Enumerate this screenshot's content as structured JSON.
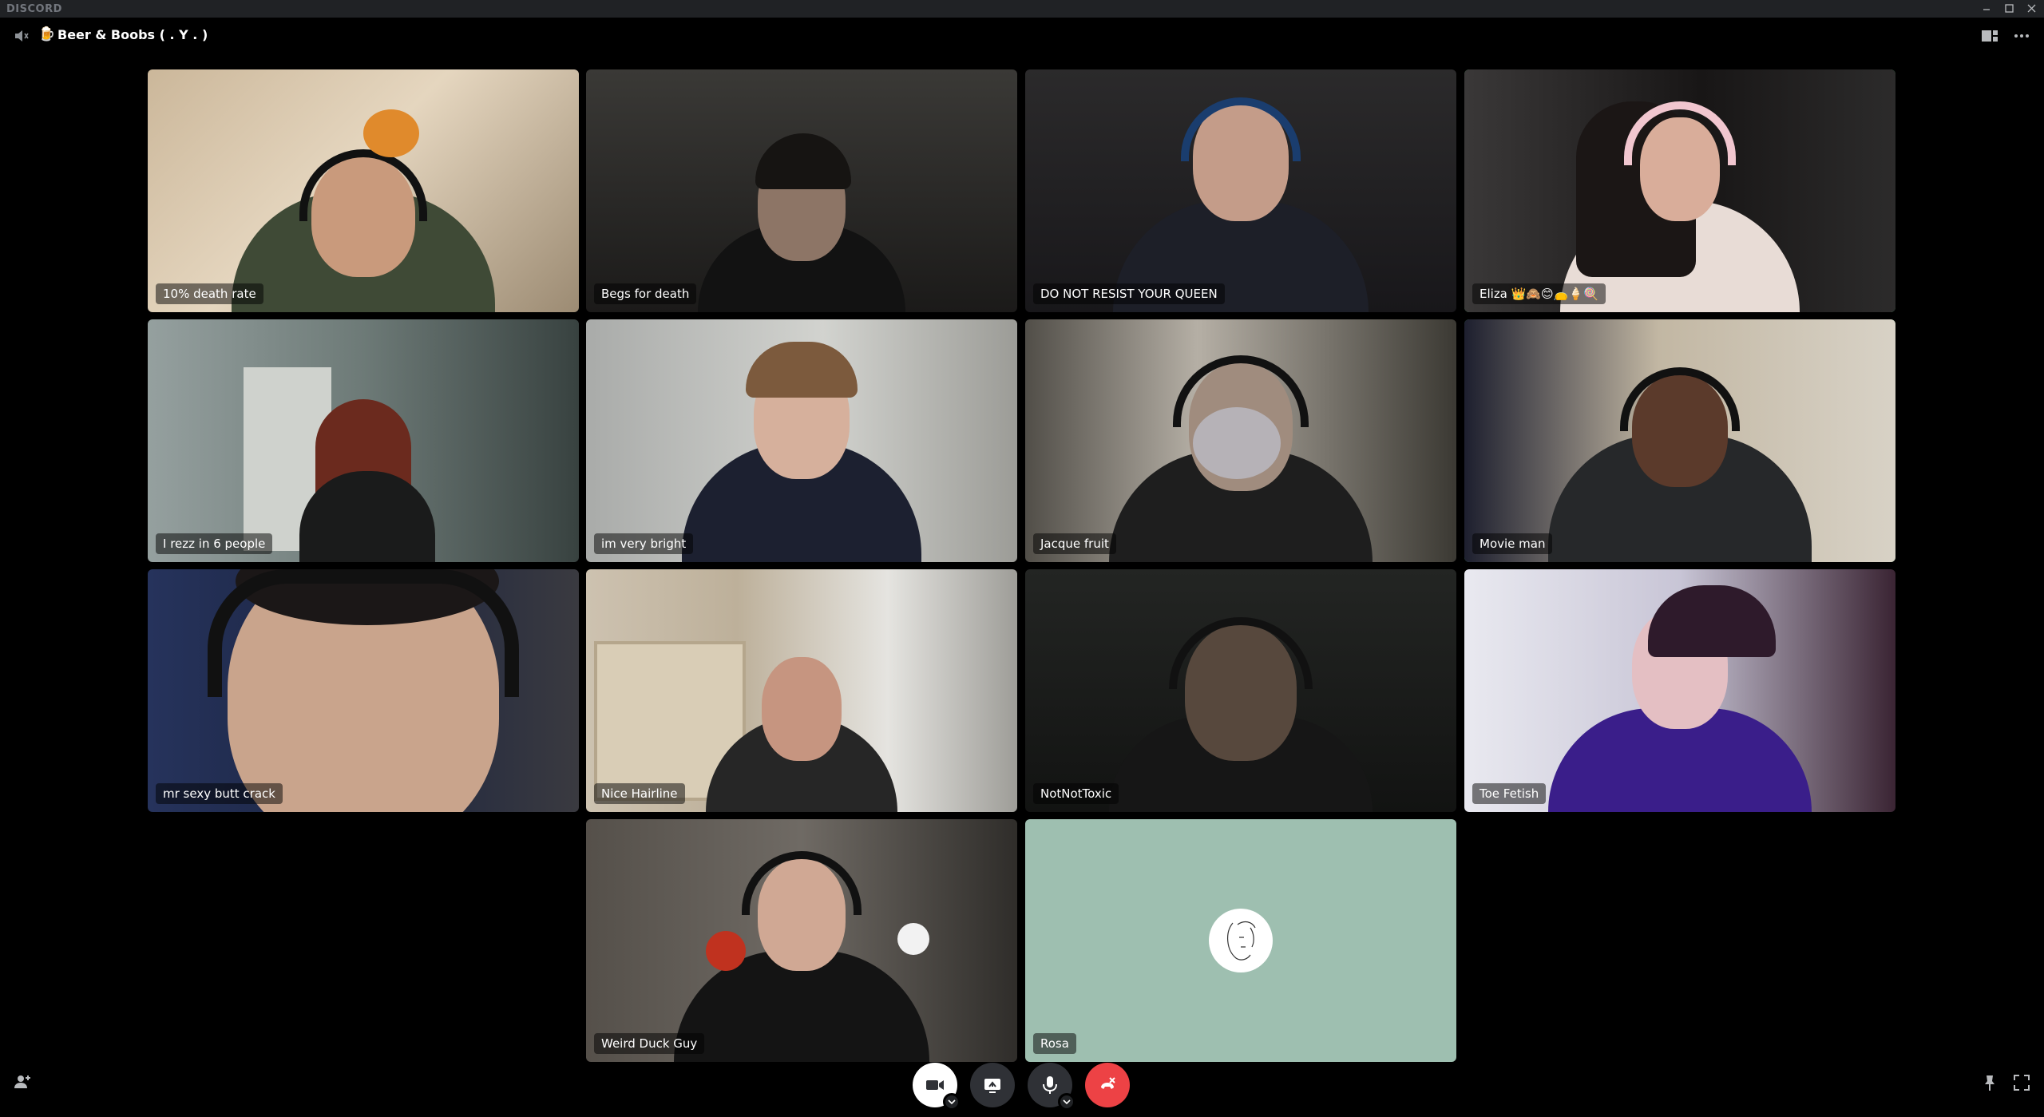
{
  "window": {
    "app_title": "DISCORD"
  },
  "header": {
    "channel_emoji": "🍺",
    "channel_name": "Beer & Boobs ( . Y . )"
  },
  "participants": [
    {
      "name": "10% death rate",
      "speaking": false
    },
    {
      "name": "Begs for death",
      "speaking": false
    },
    {
      "name": "DO NOT RESIST YOUR QUEEN",
      "speaking": false
    },
    {
      "name": "Eliza 👑🙈😊👝🍦🍭",
      "speaking": true
    },
    {
      "name": "I rezz in 6 people",
      "speaking": false
    },
    {
      "name": "im very bright",
      "speaking": false
    },
    {
      "name": "Jacque fruit",
      "speaking": false
    },
    {
      "name": "Movie man",
      "speaking": true
    },
    {
      "name": "mr sexy butt crack",
      "speaking": false
    },
    {
      "name": "Nice Hairline",
      "speaking": false
    },
    {
      "name": "NotNotToxic",
      "speaking": false
    },
    {
      "name": "Toe Fetish",
      "speaking": false
    },
    {
      "name": "Weird Duck Guy",
      "speaking": false
    },
    {
      "name": "Rosa",
      "speaking": false,
      "video": false
    }
  ],
  "icons": {
    "speaker": "speaker-muted-icon",
    "layout": "grid-layout-icon",
    "more": "more-icon",
    "invite": "add-user-icon",
    "pin": "pin-icon",
    "fullscreen": "fullscreen-icon",
    "camera": "camera-icon",
    "screen_share": "screen-share-icon",
    "mic": "microphone-icon",
    "disconnect": "disconnect-icon"
  },
  "colors": {
    "speaking_ring": "#3ba55d",
    "disconnect": "#ed4245",
    "rosa_tile": "#9ebfb0",
    "control_dark": "#2f3136"
  }
}
